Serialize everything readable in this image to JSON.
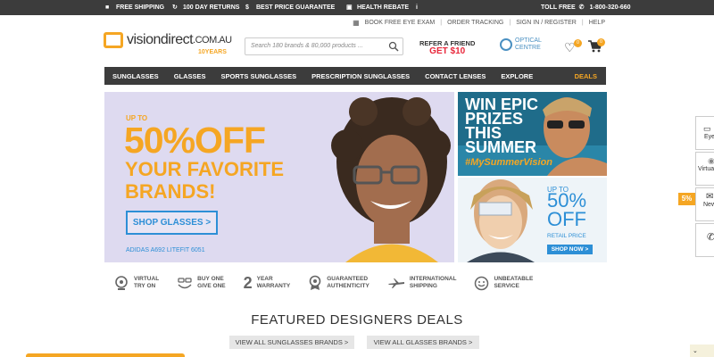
{
  "topbar": {
    "free_shipping": "FREE SHIPPING",
    "returns": "100 DAY RETURNS",
    "best_price": "BEST PRICE GUARANTEE",
    "health_rebate": "HEALTH REBATE",
    "info": "i",
    "toll_free_label": "TOLL FREE",
    "phone": "1-800-320-660"
  },
  "utility": {
    "book_exam": "BOOK FREE EYE EXAM",
    "order_tracking": "ORDER TRACKING",
    "sign_in": "SIGN IN / REGISTER",
    "help": "HELP"
  },
  "logo": {
    "name": "visiondirect",
    "domain": ".COM.AU",
    "years": "10YEARS"
  },
  "search": {
    "placeholder": "Search 180 brands & 80,000 products ..."
  },
  "refer": {
    "line1": "REFER A FRIEND",
    "line2": "GET $10"
  },
  "optical": {
    "line1": "OPTICAL",
    "line2": "CENTRE"
  },
  "header_icons": {
    "wishlist_count": "0",
    "cart_count": "0"
  },
  "nav": {
    "items": [
      "SUNGLASSES",
      "GLASSES",
      "SPORTS SUNGLASSES",
      "PRESCRIPTION SUNGLASSES",
      "CONTACT LENSES",
      "EXPLORE"
    ],
    "deals": "DEALS"
  },
  "hero": {
    "upto": "UP TO",
    "headline": "50%OFF",
    "subhead": "YOUR FAVORITE BRANDS!",
    "cta": "SHOP GLASSES >",
    "caption": "ADIDAS A692 LITEFIT 6051"
  },
  "win_banner": {
    "title": "WIN EPIC PRIZES THIS SUMMER",
    "hashtag": "#MySummerVision"
  },
  "promo_banner": {
    "upto": "UP TO",
    "pct": "50%",
    "off": "OFF",
    "retail": "RETAIL PRICE",
    "cta": "SHOP NOW >"
  },
  "features": [
    {
      "line1": "VIRTUAL",
      "line2": "TRY ON"
    },
    {
      "line1": "BUY ONE",
      "line2": "GIVE ONE"
    },
    {
      "line1": "YEAR",
      "line2": "WARRANTY"
    },
    {
      "line1": "GUARANTEED",
      "line2": "AUTHENTICITY"
    },
    {
      "line1": "INTERNATIONAL",
      "line2": "SHIPPING"
    },
    {
      "line1": "UNBEATABLE",
      "line2": "SERVICE"
    }
  ],
  "featured": {
    "title": "FEATURED DESIGNERS DEALS",
    "sunglasses_btn": "VIEW ALL SUNGLASSES BRANDS >",
    "glasses_btn": "VIEW ALL GLASSES BRANDS >"
  },
  "side_tabs": [
    {
      "label": "Eye"
    },
    {
      "label": "Virtua"
    },
    {
      "label": "New"
    },
    {
      "label": ""
    }
  ],
  "side_badge": "5%",
  "colors": {
    "accent": "#f5a623",
    "blue": "#2d8fd6",
    "dark": "#3c3c3c",
    "red": "#e8263a"
  }
}
